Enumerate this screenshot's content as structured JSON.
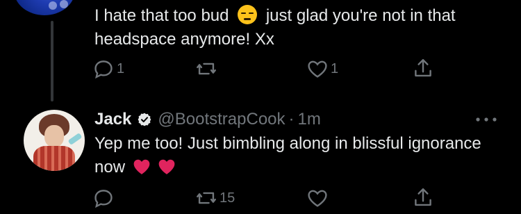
{
  "reply1": {
    "text_before_emoji": "I hate that too bud",
    "text_after_emoji": "just glad you're not in that headspace anymore! Xx",
    "emoji": "unamused-face",
    "actions": {
      "reply_count": "1",
      "retweet_count": "",
      "like_count": "1"
    }
  },
  "reply2": {
    "name": "Jack",
    "verified": true,
    "handle": "@BootstrapCook",
    "separator": "·",
    "time": "1m",
    "text": "Yep me too! Just bimbling along in blissful ignorance now",
    "emoji": "red-heart x2",
    "actions": {
      "reply_count": "",
      "retweet_count": "15",
      "like_count": ""
    }
  },
  "colors": {
    "background": "#000000",
    "text": "#e7e9ea",
    "muted": "#71767b",
    "thread_line": "#333639",
    "heart_red": "#e0245e"
  }
}
